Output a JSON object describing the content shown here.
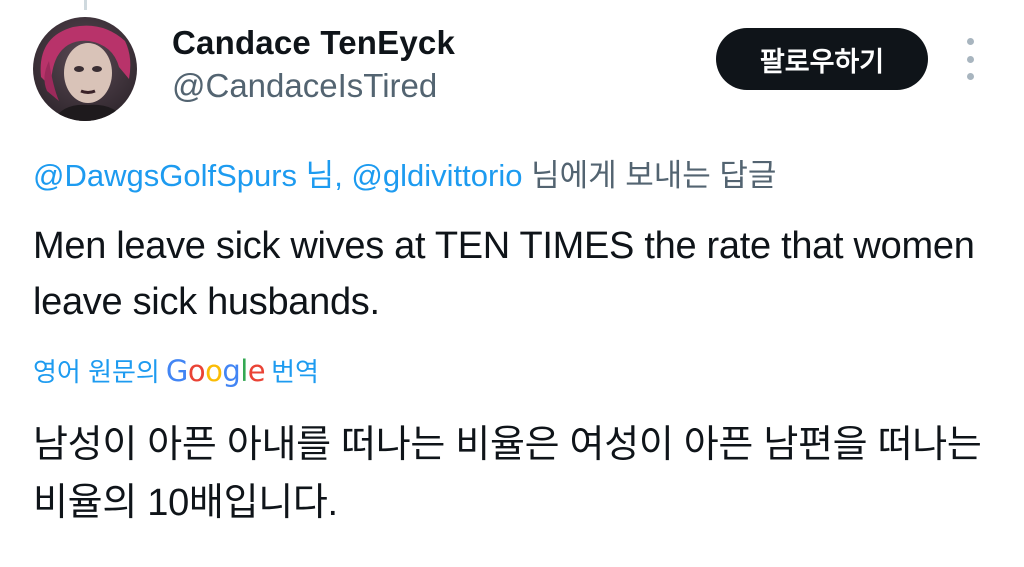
{
  "author": {
    "display_name": "Candace TenEyck",
    "handle": "@CandaceIsTired"
  },
  "header": {
    "follow_label": "팔로우하기",
    "more_icon": "more-vertical-icon"
  },
  "reply_to": {
    "mention_1": "@DawgsGolfSpurs",
    "sep_1": " 님, ",
    "mention_2": "@gldivittorio",
    "suffix": " 님에게 보내는 답글"
  },
  "tweet": {
    "text": "Men leave sick wives at TEN TIMES the rate that women leave sick husbands."
  },
  "translation": {
    "prefix": "영어 원문의",
    "logo_text": "Google",
    "suffix": "번역",
    "text": "남성이 아픈 아내를 떠나는 비율은 여성이 아픈 남편을 떠나는 비율의 10배입니다."
  },
  "colors": {
    "link": "#1d9bf0",
    "secondary_text": "#536471",
    "primary_text": "#0f1419",
    "button_bg": "#0f1419"
  }
}
